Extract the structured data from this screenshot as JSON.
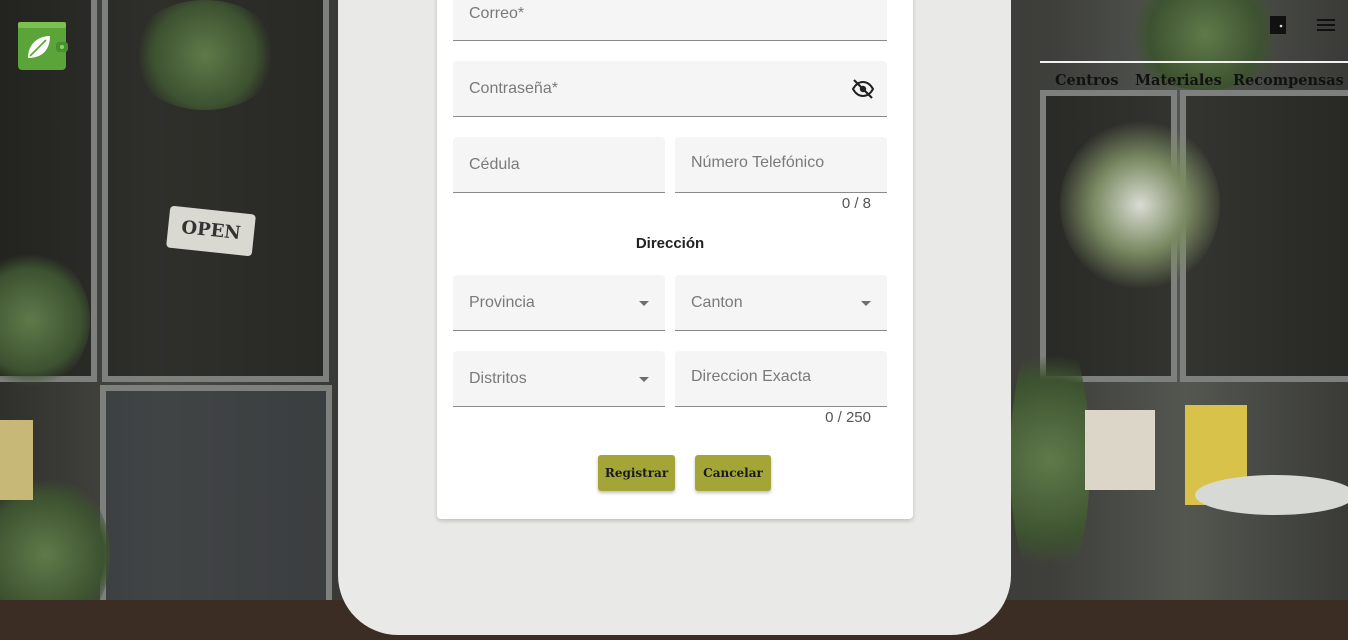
{
  "form": {
    "email_label": "Correo*",
    "password_label": "Contraseña*",
    "id_label": "Cédula",
    "phone_label": "Número Telefónico",
    "phone_counter": "0 / 8",
    "address_title": "Dirección",
    "province_label": "Provincia",
    "canton_label": "Canton",
    "district_label": "Distritos",
    "exact_address_label": "Direccion Exacta",
    "exact_address_counter": "0 / 250",
    "register_label": "Registrar",
    "cancel_label": "Cancelar"
  },
  "nav": {
    "items": [
      "Centros",
      "Materiales",
      "Recompensas"
    ]
  },
  "background_sign": "OPEN",
  "colors": {
    "accent": "#a3a637",
    "logo_green": "#5aa43a",
    "card_bg": "#ffffff",
    "field_bg": "#f5f5f5"
  },
  "icons": {
    "password_toggle": "eye-off-icon",
    "logout": "door-icon",
    "menu": "hamburger-menu-icon",
    "logo": "leaf-wallet-logo"
  }
}
